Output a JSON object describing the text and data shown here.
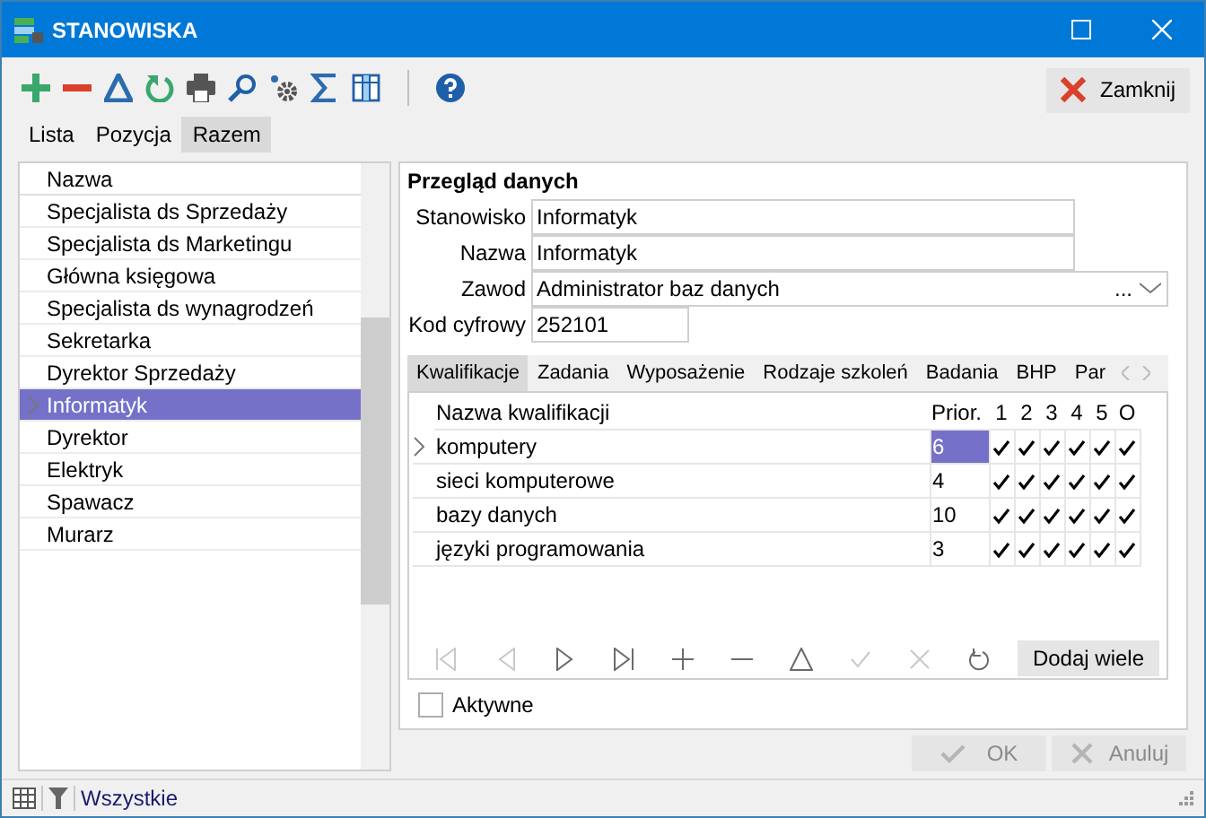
{
  "window": {
    "title": "STANOWISKA"
  },
  "toolbar": [
    {
      "kind": "add"
    },
    {
      "kind": "remove"
    },
    {
      "kind": "edit"
    },
    {
      "kind": "refresh"
    },
    {
      "kind": "print"
    },
    {
      "kind": "search"
    },
    {
      "kind": "settings"
    },
    {
      "kind": "sum"
    },
    {
      "kind": "columns"
    },
    {
      "kind": "separator"
    },
    {
      "kind": "help"
    }
  ],
  "close_button": "Zamknij",
  "view_tabs": [
    {
      "label": "Lista",
      "selected": false
    },
    {
      "label": "Pozycja",
      "selected": false
    },
    {
      "label": "Razem",
      "selected": true
    }
  ],
  "list": {
    "header": "Nazwa",
    "items": [
      {
        "label": "Specjalista ds Sprzedaży",
        "selected": false
      },
      {
        "label": "Specjalista ds Marketingu",
        "selected": false
      },
      {
        "label": "Główna księgowa",
        "selected": false
      },
      {
        "label": "Specjalista ds wynagrodzeń",
        "selected": false
      },
      {
        "label": "Sekretarka",
        "selected": false
      },
      {
        "label": "Dyrektor Sprzedaży",
        "selected": false
      },
      {
        "label": "Informatyk",
        "selected": true
      },
      {
        "label": "Dyrektor",
        "selected": false
      },
      {
        "label": "Elektryk",
        "selected": false
      },
      {
        "label": "Spawacz",
        "selected": false
      },
      {
        "label": "Murarz",
        "selected": false
      }
    ]
  },
  "details": {
    "title": "Przegląd danych",
    "fields": [
      {
        "label": "Stanowisko",
        "value": "Informatyk",
        "kind": "text"
      },
      {
        "label": "Nazwa",
        "value": "Informatyk",
        "kind": "text"
      },
      {
        "label": "Zawod",
        "value": "Administrator baz danych",
        "kind": "combo",
        "button": "..."
      },
      {
        "label": "Kod cyfrowy",
        "value": "252101",
        "kind": "short"
      }
    ]
  },
  "detail_tabs": [
    {
      "label": "Kwalifikacje",
      "selected": true
    },
    {
      "label": "Zadania",
      "selected": false
    },
    {
      "label": "Wyposażenie",
      "selected": false
    },
    {
      "label": "Rodzaje szkoleń",
      "selected": false
    },
    {
      "label": "Badania",
      "selected": false
    },
    {
      "label": "BHP",
      "selected": false
    },
    {
      "label": "Par",
      "selected": false
    }
  ],
  "grid": {
    "columns": [
      "Nazwa kwalifikacji",
      "Prior.",
      "1",
      "2",
      "3",
      "4",
      "5",
      "O"
    ],
    "rows": [
      {
        "name": "komputery",
        "prior": "6",
        "current": true,
        "checks": [
          true,
          true,
          true,
          true,
          true,
          true
        ]
      },
      {
        "name": "sieci komputerowe",
        "prior": "4",
        "current": false,
        "checks": [
          true,
          true,
          true,
          true,
          true,
          true
        ]
      },
      {
        "name": "bazy danych",
        "prior": "10",
        "current": false,
        "checks": [
          true,
          true,
          true,
          true,
          true,
          true
        ]
      },
      {
        "name": "języki programowania",
        "prior": "3",
        "current": false,
        "checks": [
          true,
          true,
          true,
          true,
          true,
          true
        ]
      }
    ]
  },
  "navigator": {
    "buttons": [
      {
        "kind": "first",
        "disabled": true
      },
      {
        "kind": "prev",
        "disabled": true
      },
      {
        "kind": "next",
        "disabled": false
      },
      {
        "kind": "last",
        "disabled": false
      },
      {
        "kind": "add",
        "disabled": false
      },
      {
        "kind": "remove",
        "disabled": false
      },
      {
        "kind": "edit",
        "disabled": false
      },
      {
        "kind": "post",
        "disabled": true
      },
      {
        "kind": "cancel",
        "disabled": true
      },
      {
        "kind": "refresh",
        "disabled": false
      }
    ],
    "add_many": "Dodaj wiele"
  },
  "active_checkbox": {
    "label": "Aktywne",
    "checked": false
  },
  "ok_button": {
    "label": "OK",
    "disabled": true
  },
  "cancel_button": {
    "label": "Anuluj",
    "disabled": true
  },
  "status_bar": {
    "filter": "Wszystkie"
  }
}
